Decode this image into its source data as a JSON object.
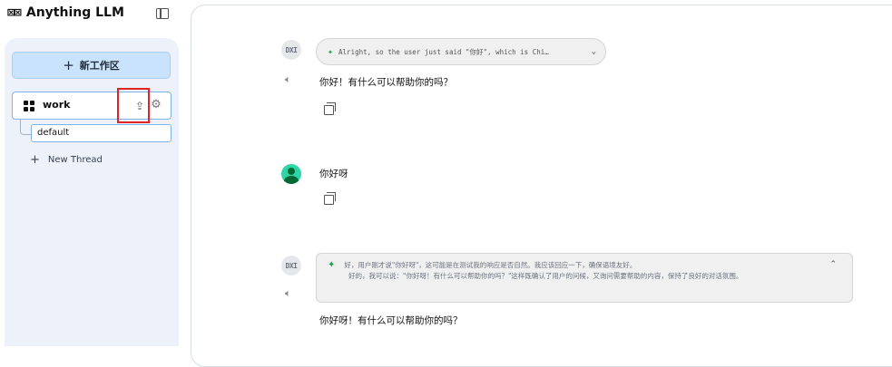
{
  "brand": {
    "logo": "⊠⊠",
    "name": "Anything LLM"
  },
  "sidebar": {
    "new_workspace_label": "新工作区",
    "workspace": {
      "name": "work"
    },
    "thread": {
      "name": "default"
    },
    "new_thread_label": "New Thread"
  },
  "chat": {
    "bot_avatar_text": "DXI",
    "msg1": {
      "thought_preview": "Alright, so the user just said \"你好\", which is Chi…",
      "reply": "你好！有什么可以帮助你的吗？"
    },
    "msg2": {
      "user_text": "你好呀"
    },
    "msg3": {
      "thought_line1": "好，用户刚才说\"你好呀\"，这可能是在测试我的响应是否自然。我应该回应一下，确保语境友好。",
      "thought_line2": "好的，我可以说：\"你好呀！有什么可以帮助你的吗？\"这样既确认了用户的问候，又询问需要帮助的内容，保持了良好的对话氛围。",
      "reply": "你好呀！有什么可以帮助你的吗？"
    }
  },
  "icons": {
    "speaker": "🔈︎",
    "brain": "✦",
    "chevron_down": "⌄",
    "chevron_up": "⌃",
    "upload": "⇪",
    "gear": "⚙"
  },
  "colors": {
    "accent_blue": "#c8e3fb",
    "highlight_red": "#e02424",
    "brain_green": "#16a34a",
    "user_avatar": "#2dd4a6"
  }
}
